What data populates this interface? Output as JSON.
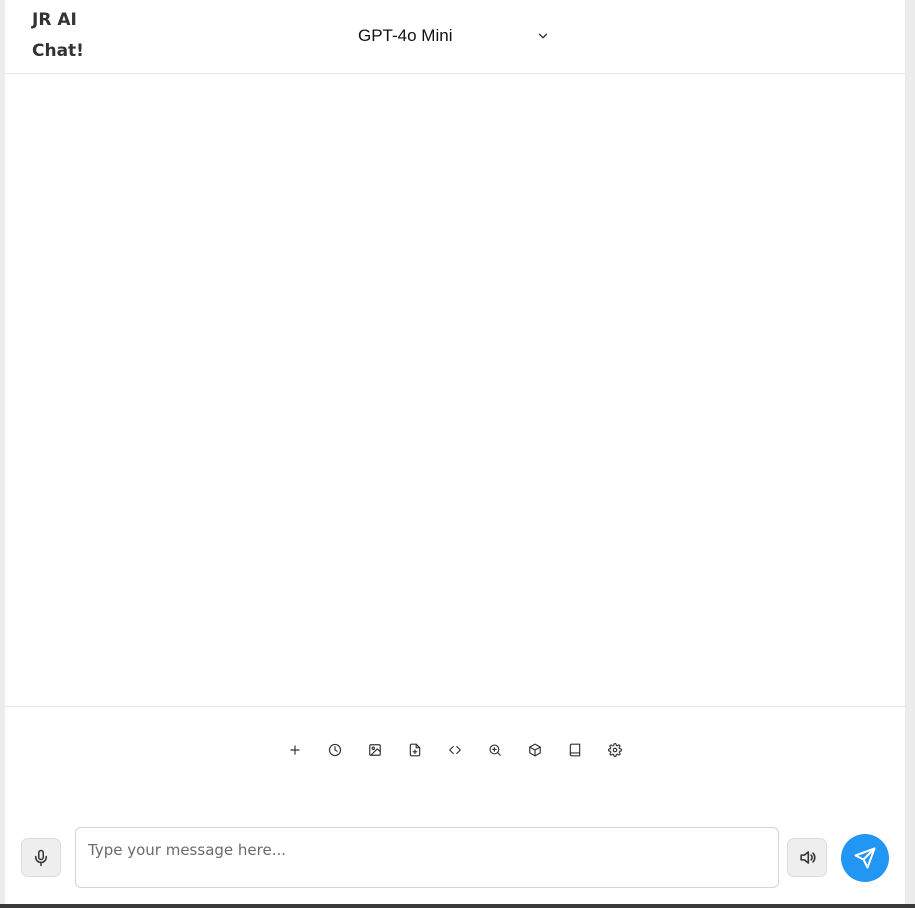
{
  "header": {
    "title_line1": "JR AI",
    "title_line2": "Chat!",
    "model_select": {
      "selected": "GPT-4o Mini",
      "icon": "chevron-down-icon"
    }
  },
  "toolbar": {
    "items": [
      {
        "name": "new-chat",
        "icon": "plus-icon"
      },
      {
        "name": "history",
        "icon": "clock-icon"
      },
      {
        "name": "image",
        "icon": "image-icon"
      },
      {
        "name": "file",
        "icon": "file-plus-icon"
      },
      {
        "name": "code",
        "icon": "code-icon"
      },
      {
        "name": "zoom",
        "icon": "zoom-in-icon"
      },
      {
        "name": "model-3d",
        "icon": "cube-icon"
      },
      {
        "name": "library",
        "icon": "book-icon"
      },
      {
        "name": "settings",
        "icon": "gear-icon"
      }
    ]
  },
  "composer": {
    "placeholder": "Type your message here...",
    "value": "",
    "mic_icon": "microphone-icon",
    "speaker_icon": "speaker-icon",
    "send_icon": "send-icon"
  },
  "colors": {
    "accent": "#2196f3",
    "icon": "#333333",
    "border": "#d4d4d4"
  }
}
